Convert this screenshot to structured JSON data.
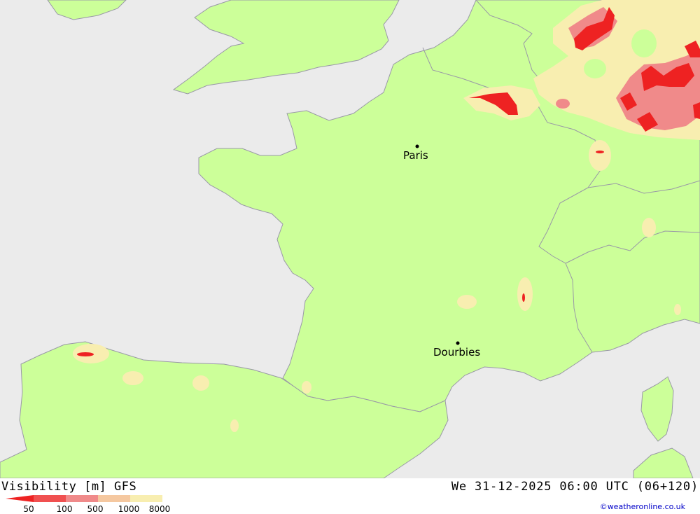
{
  "title": {
    "left": "Visibility [m] GFS",
    "right": "We 31-12-2025 06:00 UTC (06+120)"
  },
  "cities": [
    {
      "name": "Paris"
    },
    {
      "name": "Dourbies"
    }
  ],
  "legend": {
    "ticks": [
      "50",
      "100",
      "500",
      "1000",
      "8000"
    ],
    "colors": [
      "#ee2222",
      "#f05050",
      "#f08a8a",
      "#f5c8a0",
      "#f8eeb0"
    ]
  },
  "colors": {
    "sea": "#ebebeb",
    "land": "#ccff99",
    "light_band": "#f8eeb0",
    "mid_band": "#f08a8a",
    "dark_band": "#ee2222",
    "coast": "#9999a6"
  },
  "copyright": "©weatheronline.co.uk"
}
